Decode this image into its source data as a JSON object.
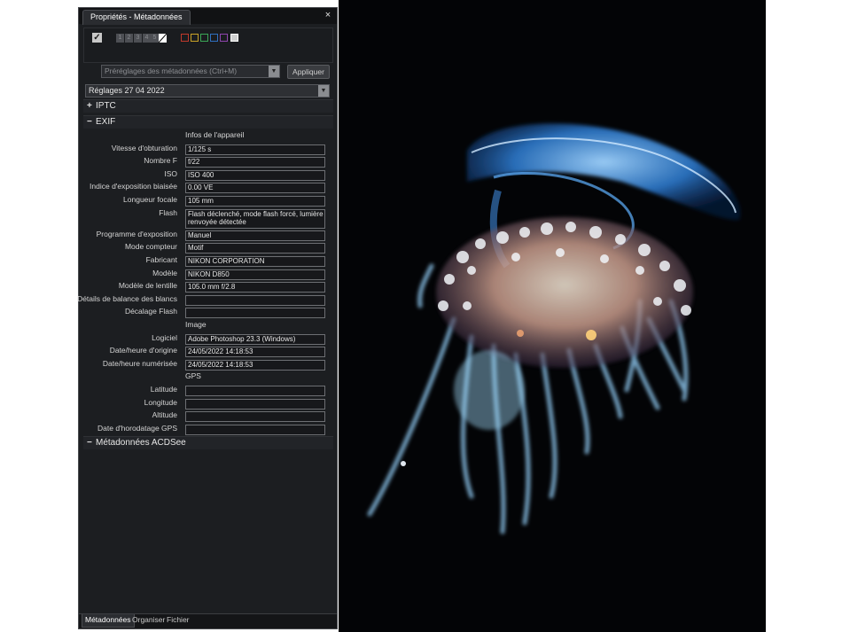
{
  "panel": {
    "title": "Propriétés - Métadonnées",
    "close_glyph": "×",
    "ratings": [
      "1",
      "2",
      "3",
      "4",
      "5"
    ],
    "label_colors": [
      "#c0392b",
      "#c9a227",
      "#3aa655",
      "#2f6fbf",
      "#8e44ad",
      "#ffffff"
    ],
    "preset_placeholder": "Préréglages des métadonnées (Ctrl+M)",
    "apply_label": "Appliquer",
    "reglages_value": "Réglages 27 04 2022",
    "sections": {
      "iptc": "IPTC",
      "exif": "EXIF",
      "acdsee": "Métadonnées ACDSee"
    },
    "expand_sign": "+",
    "collapse_sign": "−"
  },
  "exif": {
    "camera_header": "Infos de l'appareil",
    "camera": [
      {
        "label": "Vitesse d'obturation",
        "value": "1/125 s"
      },
      {
        "label": "Nombre F",
        "value": "f/22"
      },
      {
        "label": "ISO",
        "value": "ISO 400"
      },
      {
        "label": "Indice d'exposition biaisée",
        "value": "0.00 VE"
      },
      {
        "label": "Longueur focale",
        "value": "105 mm"
      },
      {
        "label": "Flash",
        "value": "Flash déclenché, mode flash forcé, lumière renvoyée détectée"
      },
      {
        "label": "Programme d'exposition",
        "value": "Manuel"
      },
      {
        "label": "Mode compteur",
        "value": "Motif"
      },
      {
        "label": "Fabricant",
        "value": "NIKON CORPORATION"
      },
      {
        "label": "Modèle",
        "value": "NIKON D850"
      },
      {
        "label": "Modèle de lentille",
        "value": "105.0 mm f/2.8"
      },
      {
        "label": "Détails de balance des blancs",
        "value": ""
      },
      {
        "label": "Décalage Flash",
        "value": ""
      }
    ],
    "image_header": "Image",
    "image": [
      {
        "label": "Logiciel",
        "value": "Adobe Photoshop 23.3 (Windows)"
      },
      {
        "label": "Date/heure d'origine",
        "value": "24/05/2022 14:18:53"
      },
      {
        "label": "Date/heure numérisée",
        "value": "24/05/2022 14:18:53"
      }
    ],
    "gps_header": "GPS",
    "gps": [
      {
        "label": "Latitude",
        "value": ""
      },
      {
        "label": "Longitude",
        "value": ""
      },
      {
        "label": "Altitude",
        "value": ""
      },
      {
        "label": "Date d'horodatage GPS",
        "value": ""
      }
    ]
  },
  "bottom_tabs": [
    "Métadonnées",
    "Organiser",
    "Fichier"
  ]
}
